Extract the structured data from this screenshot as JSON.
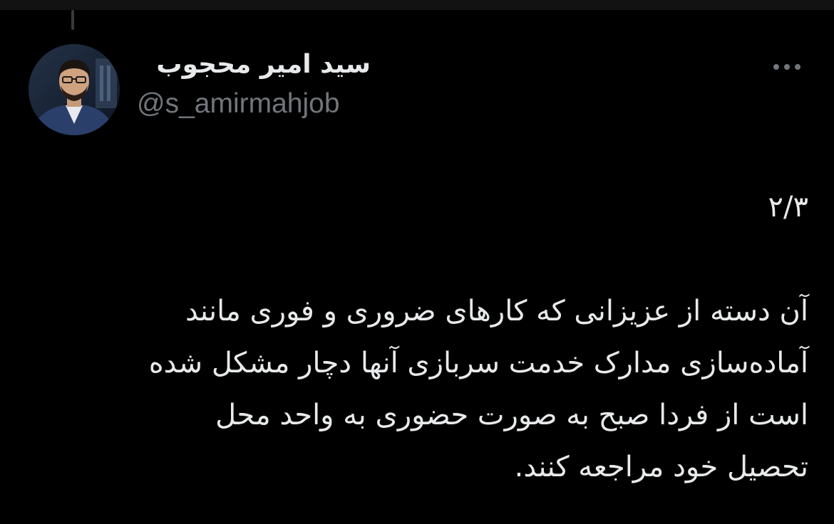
{
  "author": {
    "display_name": "سید امیر محجوب",
    "handle": "@s_amirmahjob",
    "avatar_icon": "profile-photo"
  },
  "menu": {
    "more_icon": "more-horizontal-icon"
  },
  "tweet": {
    "thread_counter": "۲/۳",
    "text": "آن دسته از عزیزانی که کارهای ضروری و فوری مانند\nآماده‌سازی مدارک خدمت سربازی آنها دچار مشکل شده\nاست از فردا صبح به صورت حضوری به واحد محل\nتحصیل خود مراجعه کنند."
  },
  "colors": {
    "background": "#000000",
    "text_primary": "#e7e9ea",
    "text_secondary": "#71767b"
  }
}
